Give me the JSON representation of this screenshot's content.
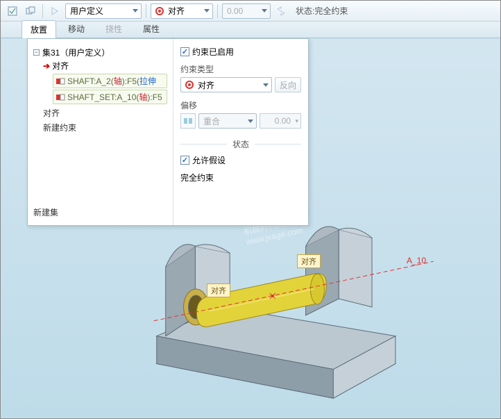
{
  "toolbar": {
    "constraint_type_combo": "用户定义",
    "align_combo": "对齐",
    "num_value": "0.00",
    "status_prefix": "状态:",
    "status_value": "完全约束"
  },
  "tabs": {
    "placement": "放置",
    "move": "移动",
    "flex": "挠性",
    "properties": "属性"
  },
  "tree": {
    "root_label": "集31（用户定义）",
    "active_item": "对齐",
    "ref1_prefix": "SHAFT:A_2(",
    "ref1_mid": "轴",
    "ref1_suffix": "):F5(",
    "ref1_end": "拉伸",
    "ref2_prefix": "SHAFT_SET:A_10(",
    "ref2_mid": "轴",
    "ref2_suffix": "):F5",
    "plain1": "对齐",
    "plain2": "新建约束",
    "new_set": "新建集"
  },
  "right": {
    "enabled_label": "约束已启用",
    "type_label": "约束类型",
    "type_value": "对齐",
    "reverse_btn": "反向",
    "offset_label": "偏移",
    "offset_combo": "重合",
    "offset_value": "0.00",
    "state_header": "状态",
    "allow_assume": "允许假设",
    "full_constraint": "完全约束"
  },
  "viewport": {
    "tag1": "对齐",
    "tag2": "对齐",
    "axis_label": "A_10"
  },
  "watermark": {
    "line1": "机械时代网",
    "line2": "www.jxage.com"
  }
}
